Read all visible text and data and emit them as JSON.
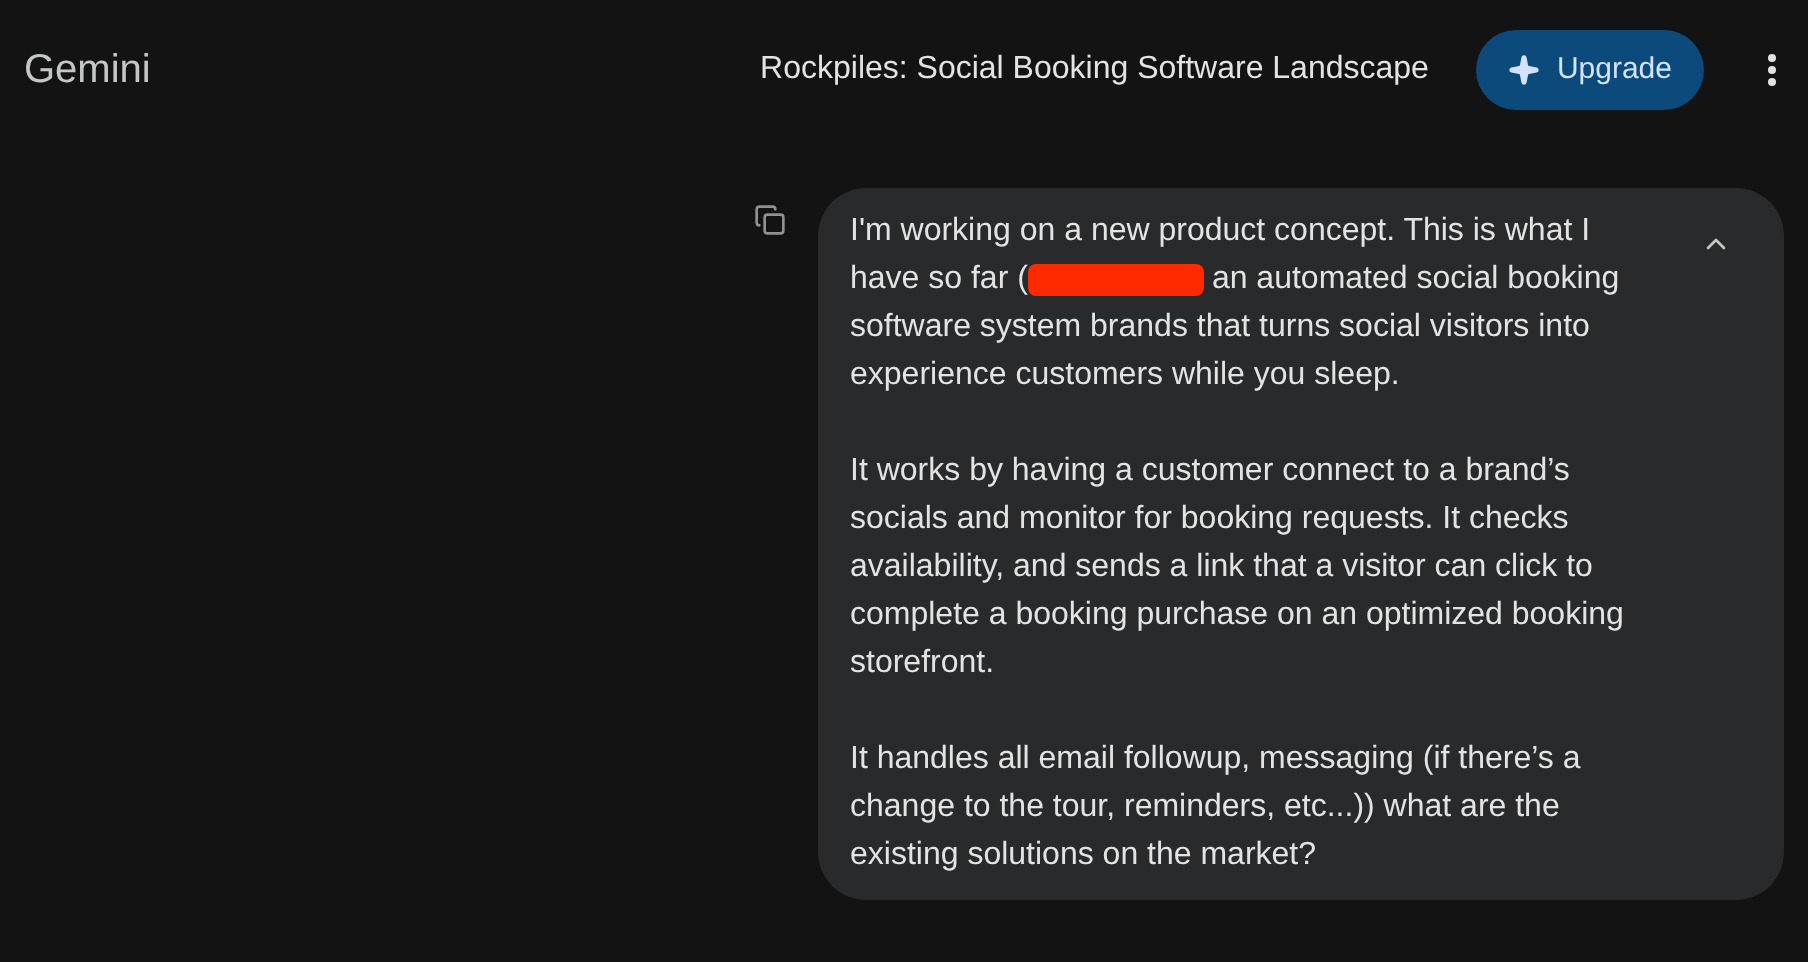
{
  "app": {
    "name": "Gemini"
  },
  "header": {
    "title": "Rockpiles: Social Booking Software Landscape",
    "upgrade_button": "Upgrade"
  },
  "message": {
    "expanded": true,
    "intro_first_line": "I'm working on a new product concept. This is what I",
    "intro_before_redaction": "have so far (",
    "intro_after_redaction": "an automated social booking",
    "intro_rest": "software system brands that turns social visitors into experience customers while you sleep.",
    "paragraphs": [
      "It works by having a customer connect to a brand’s socials and monitor for booking requests. It checks availability, and sends a link that a visitor can click to complete a booking purchase on an optimized booking storefront.",
      "It handles all email followup, messaging (if there’s a change to the tour, reminders, etc...)) what are the existing solutions on the market?"
    ]
  }
}
